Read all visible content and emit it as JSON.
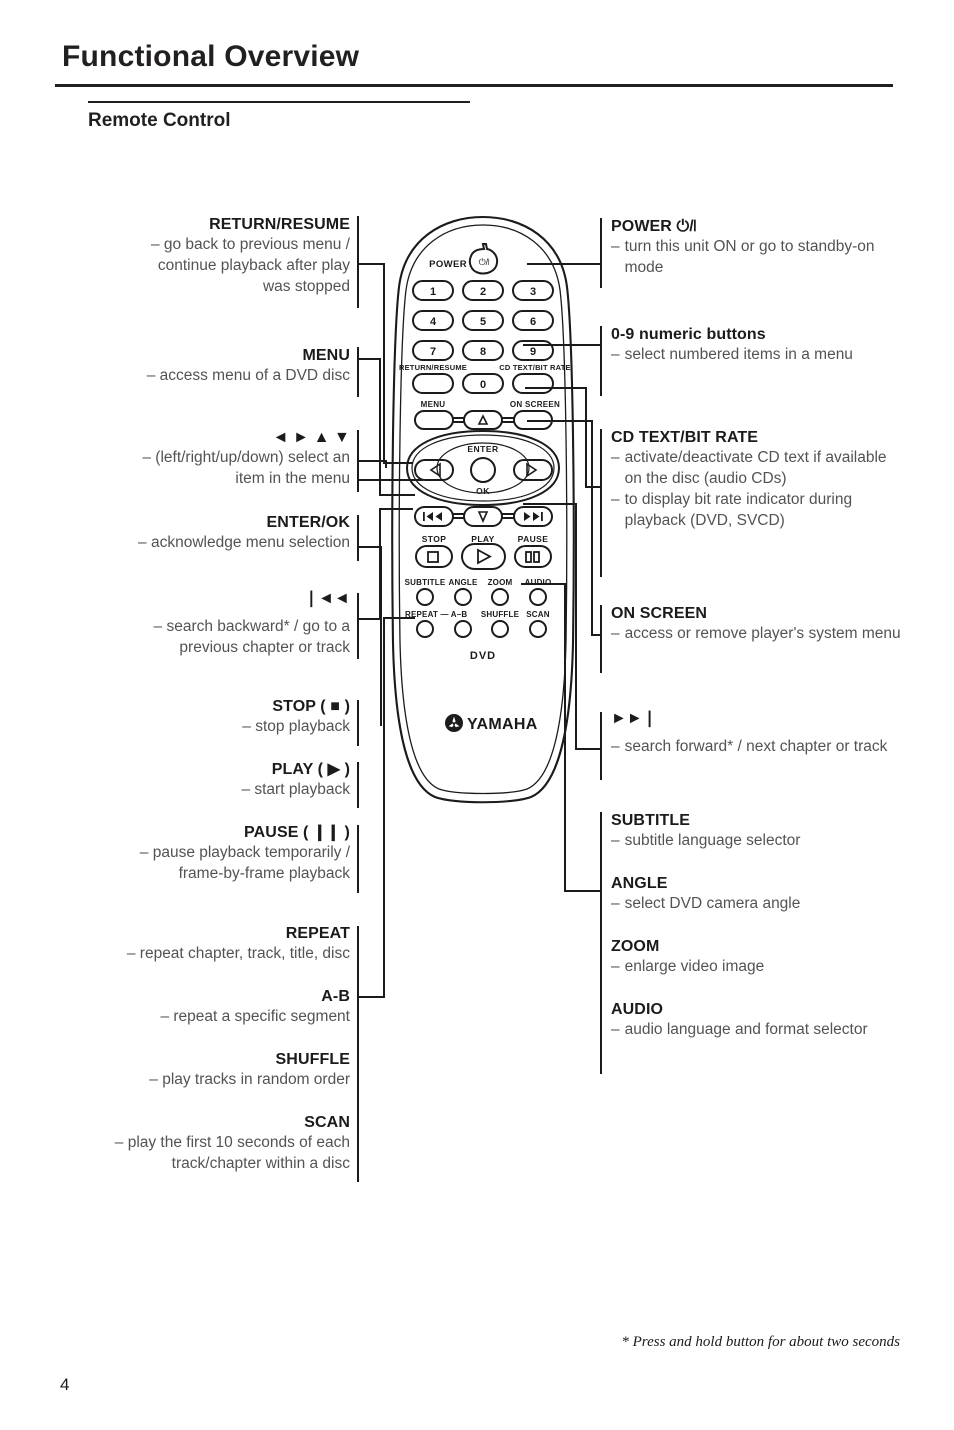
{
  "header": {
    "title": "Functional Overview",
    "section": "Remote Control"
  },
  "footer": {
    "footnote": "* Press and hold button for about two seconds",
    "page_number": "4"
  },
  "left_callouts": [
    {
      "id": "return-resume",
      "heading": "RETURN/RESUME",
      "lines": [
        "– go back to previous menu /",
        "continue playback after play",
        "was stopped"
      ]
    },
    {
      "id": "menu",
      "heading": "MENU",
      "lines": [
        "– access menu of a DVD disc"
      ]
    },
    {
      "id": "arrows",
      "heading": "◄ ► ▲ ▼",
      "lines": [
        "– (left/right/up/down) select an",
        "item in the menu"
      ]
    },
    {
      "id": "enter-ok",
      "heading": "ENTER/OK",
      "lines": [
        "– acknowledge menu selection"
      ]
    },
    {
      "id": "search-backward",
      "heading": "❘◄◄",
      "lines": [
        "– search backward* / go to a",
        "previous chapter or track"
      ]
    },
    {
      "id": "stop",
      "heading": "STOP ( ■ )",
      "lines": [
        "– stop playback"
      ]
    },
    {
      "id": "play",
      "heading": "PLAY ( ▶ )",
      "lines": [
        "– start playback"
      ]
    },
    {
      "id": "pause",
      "heading": "PAUSE ( ❙❙ )",
      "lines": [
        "– pause playback temporarily /",
        "frame-by-frame playback"
      ]
    },
    {
      "id": "repeat",
      "heading": "REPEAT",
      "lines": [
        "– repeat chapter, track, title, disc"
      ]
    },
    {
      "id": "a-b",
      "heading": "A-B",
      "lines": [
        "– repeat a specific segment"
      ]
    },
    {
      "id": "shuffle",
      "heading": "SHUFFLE",
      "lines": [
        "– play tracks in random order"
      ]
    },
    {
      "id": "scan",
      "heading": "SCAN",
      "lines": [
        "– play the first 10 seconds of each",
        "track/chapter within a disc"
      ]
    }
  ],
  "right_callouts": [
    {
      "id": "power",
      "heading": "POWER ⏻/❘",
      "items": [
        [
          "–",
          "turn this unit ON or go to standby-on mode"
        ]
      ]
    },
    {
      "id": "numeric-buttons",
      "heading": "0-9 numeric buttons",
      "items": [
        [
          "–",
          "select numbered items in a menu"
        ]
      ]
    },
    {
      "id": "cd-text-bit-rate",
      "heading": "CD TEXT/BIT RATE",
      "items": [
        [
          "–",
          "activate/deactivate CD text if available on the disc (audio CDs)"
        ],
        [
          "–",
          "to display bit rate indicator during playback (DVD, SVCD)"
        ]
      ]
    },
    {
      "id": "on-screen",
      "heading": "ON SCREEN",
      "items": [
        [
          "–",
          "access or remove player's system menu"
        ]
      ]
    },
    {
      "id": "search-forward",
      "heading": "►►❘",
      "items": [
        [
          "–",
          "search forward* / next chapter or track"
        ]
      ]
    },
    {
      "id": "subtitle",
      "heading": "SUBTITLE",
      "items": [
        [
          "–",
          "subtitle language selector"
        ]
      ]
    },
    {
      "id": "angle",
      "heading": "ANGLE",
      "items": [
        [
          "–",
          "select DVD camera angle"
        ]
      ]
    },
    {
      "id": "zoom",
      "heading": "ZOOM",
      "items": [
        [
          "–",
          "enlarge video image"
        ]
      ]
    },
    {
      "id": "audio",
      "heading": "AUDIO",
      "items": [
        [
          "–",
          "audio language and format selector"
        ]
      ]
    }
  ],
  "remote": {
    "brand": "YAMAHA",
    "disc_label": "DVD",
    "power_label": "POWER",
    "power_symbol": "⏻/❘",
    "numeric_keys": [
      "1",
      "2",
      "3",
      "4",
      "5",
      "6",
      "7",
      "8",
      "9",
      "0"
    ],
    "labels": {
      "return_resume": "RETURN/RESUME",
      "cd_text_bit_rate": "CD TEXT/BIT RATE",
      "menu": "MENU",
      "on_screen": "ON SCREEN",
      "enter": "ENTER",
      "ok": "OK",
      "stop": "STOP",
      "play": "PLAY",
      "pause": "PAUSE",
      "subtitle": "SUBTITLE",
      "angle": "ANGLE",
      "zoom": "ZOOM",
      "audio": "AUDIO",
      "repeat_ab": "REPEAT — A–B",
      "shuffle": "SHUFFLE",
      "scan": "SCAN"
    }
  }
}
